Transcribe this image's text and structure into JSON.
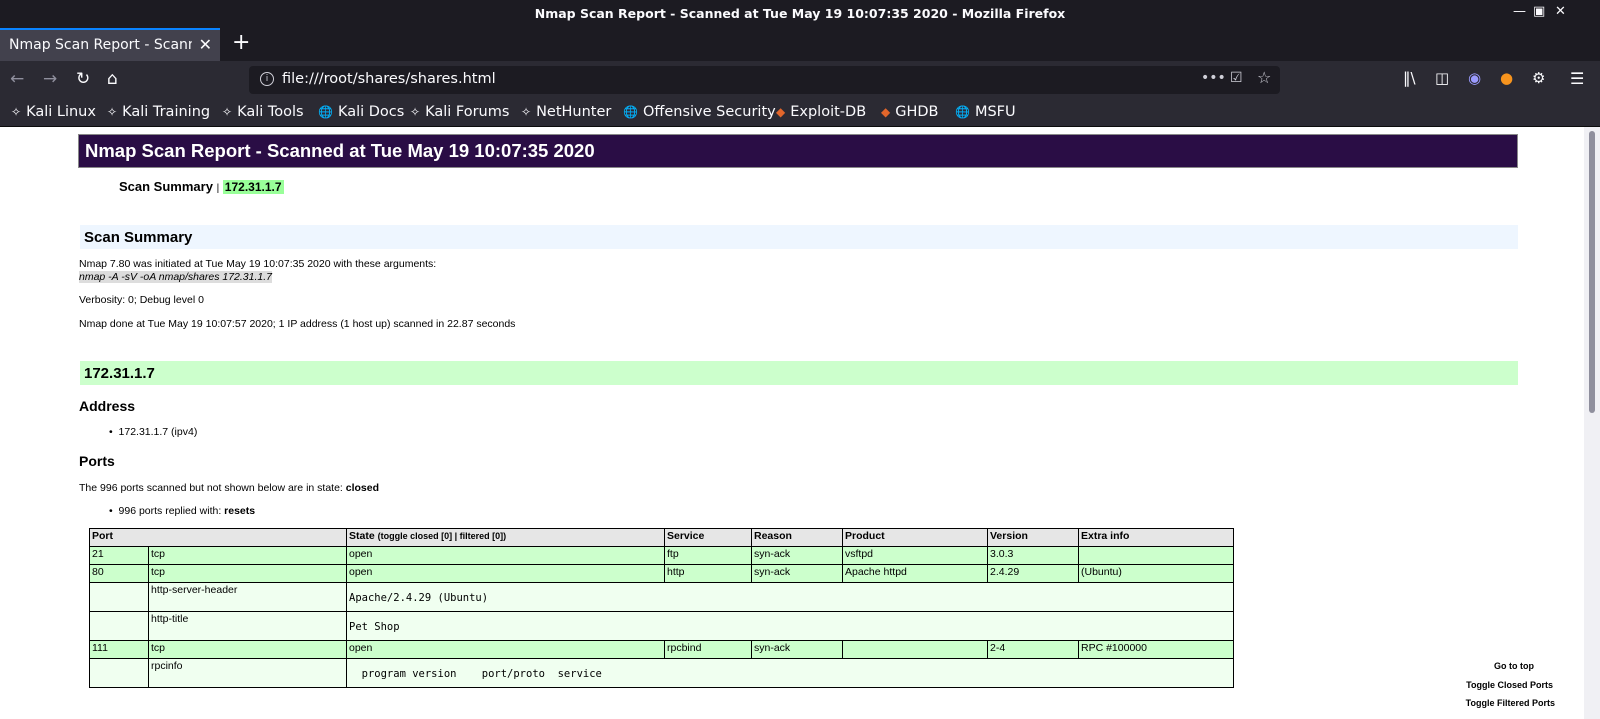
{
  "window": {
    "title": "Nmap Scan Report - Scanned at Tue May 19 10:07:35 2020 - Mozilla Firefox"
  },
  "tab": {
    "label": "Nmap Scan Report - Scanned at Tue May 19 10:07:35 2020"
  },
  "url": {
    "value": "file:///root/shares/shares.html"
  },
  "bookmarks": [
    {
      "label": "Kali Linux",
      "icon": "kali-dragon-icon"
    },
    {
      "label": "Kali Training",
      "icon": "kali-dragon-icon"
    },
    {
      "label": "Kali Tools",
      "icon": "kali-dragon-icon"
    },
    {
      "label": "Kali Docs",
      "icon": "globe-icon"
    },
    {
      "label": "Kali Forums",
      "icon": "kali-dragon-icon"
    },
    {
      "label": "NetHunter",
      "icon": "kali-dragon-icon"
    },
    {
      "label": "Offensive Security",
      "icon": "globe-icon"
    },
    {
      "label": "Exploit-DB",
      "icon": "exploitdb-icon"
    },
    {
      "label": "GHDB",
      "icon": "exploitdb-icon"
    },
    {
      "label": "MSFU",
      "icon": "globe-icon"
    }
  ],
  "report": {
    "header": "Nmap Scan Report - Scanned at Tue May 19 10:07:35 2020",
    "summary_link": "Scan Summary",
    "summary_sep": "|",
    "summary_ip": "172.31.1.7",
    "scan_summary_title": "Scan Summary",
    "initiated_line": "Nmap 7.80 was initiated at Tue May 19 10:07:35 2020 with these arguments:",
    "arguments": "nmap -A -sV -oA nmap/shares 172.31.1.7",
    "verbosity": "Verbosity: 0; Debug level 0",
    "done_line": "Nmap done at Tue May 19 10:07:57 2020; 1 IP address (1 host up) scanned in 22.87 seconds",
    "host_title": "172.31.1.7",
    "address_title": "Address",
    "address_item": "172.31.1.7 (ipv4)",
    "ports_title": "Ports",
    "ports_line_prefix": "The 996 ports scanned but not shown below are in state:",
    "ports_line_state": "closed",
    "ports_reply_prefix": "996 ports replied with:",
    "ports_reply_value": "resets",
    "table": {
      "headers": {
        "port": "Port",
        "state": "State",
        "state_toggle": "(toggle closed [0] | filtered [0])",
        "service": "Service",
        "reason": "Reason",
        "product": "Product",
        "version": "Version",
        "extra": "Extra info"
      },
      "rows": [
        {
          "port": "21",
          "proto": "tcp",
          "state": "open",
          "service": "ftp",
          "reason": "syn-ack",
          "product": "vsftpd",
          "version": "3.0.3",
          "extra": ""
        },
        {
          "port": "80",
          "proto": "tcp",
          "state": "open",
          "service": "http",
          "reason": "syn-ack",
          "product": "Apache httpd",
          "version": "2.4.29",
          "extra": "(Ubuntu)"
        },
        {
          "script": "http-server-header",
          "output": "Apache/2.4.29 (Ubuntu)"
        },
        {
          "script": "http-title",
          "output": "Pet Shop"
        },
        {
          "port": "111",
          "proto": "tcp",
          "state": "open",
          "service": "rpcbind",
          "reason": "syn-ack",
          "product": "",
          "version": "2-4",
          "extra": "RPC #100000"
        },
        {
          "script": "rpcinfo",
          "output": "  program version    port/proto  service"
        }
      ]
    },
    "nav": {
      "top": "Go to top",
      "closed": "Toggle Closed Ports",
      "filtered": "Toggle Filtered Ports"
    }
  },
  "colors": {
    "header_bg": "#2a0d45",
    "host_band": "#ccffcc",
    "summary_band": "#eef6ff",
    "open_row": "#ccffcc"
  }
}
